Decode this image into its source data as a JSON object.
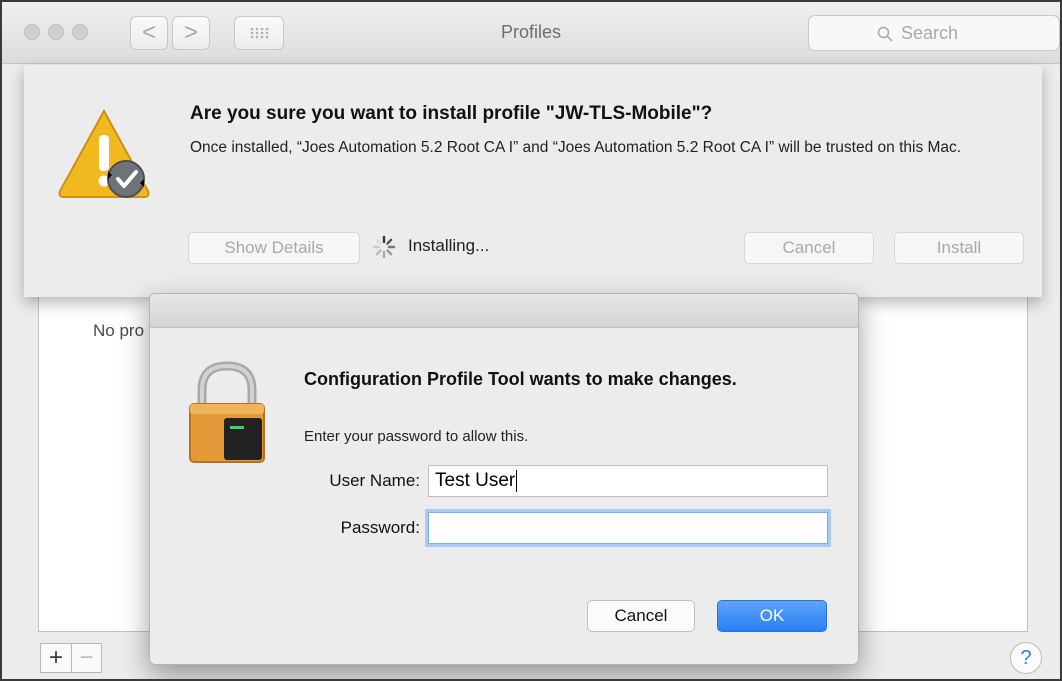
{
  "window": {
    "title": "Profiles",
    "search_placeholder": "Search",
    "nav_back_glyph": "<",
    "nav_forward_glyph": ">",
    "grid_icon": "grid-icon"
  },
  "background_panel": {
    "empty_text": "No pro",
    "add_button_glyph": "+",
    "remove_button_glyph": "−",
    "help_glyph": "?"
  },
  "install_sheet": {
    "title": "Are you sure you want to install profile \"JW-TLS-Mobile\"?",
    "message": "Once installed, “Joes Automation 5.2 Root CA I” and “Joes Automation 5.2 Root CA I” will be trusted on this Mac.",
    "show_details_label": "Show Details",
    "status_text": "Installing...",
    "cancel_label": "Cancel",
    "install_label": "Install",
    "icon": "warning-icon"
  },
  "auth_dialog": {
    "title": "Configuration Profile Tool wants to make changes.",
    "message": "Enter your password to allow this.",
    "username_label": "User Name:",
    "username_value": "Test User",
    "password_label": "Password:",
    "password_value": "",
    "cancel_label": "Cancel",
    "ok_label": "OK",
    "icon": "lock-icon"
  },
  "colors": {
    "accent": "#2a7ff3",
    "warning": "#f2b81f"
  }
}
